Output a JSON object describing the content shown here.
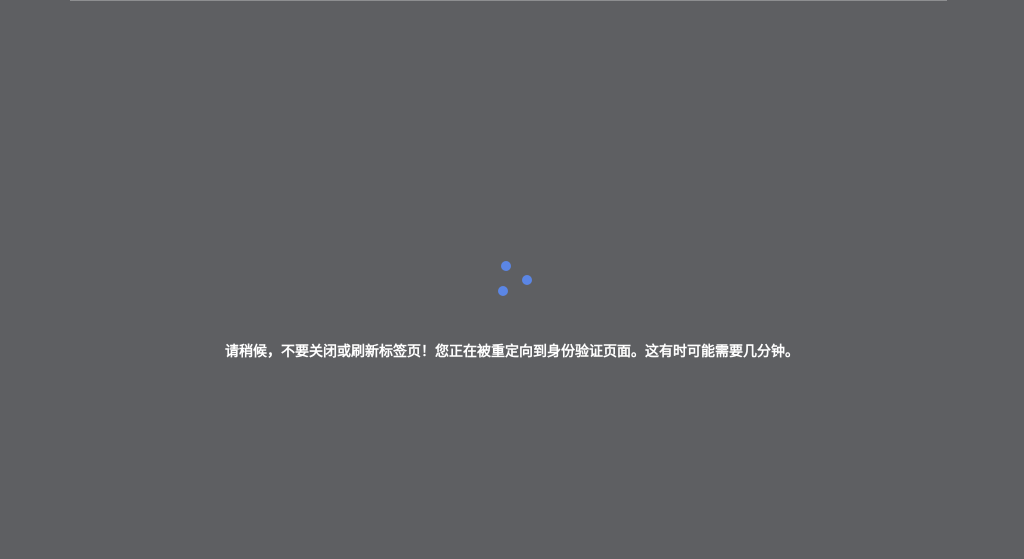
{
  "loading": {
    "message": "请稍候，不要关闭或刷新标签页！您正在被重定向到身份验证页面。这有时可能需要几分钟。",
    "spinner_icon": "loading-spinner-icon",
    "spinner_color": "#5b86e5",
    "background_color": "#5e5f62",
    "text_color": "#ffffff"
  }
}
